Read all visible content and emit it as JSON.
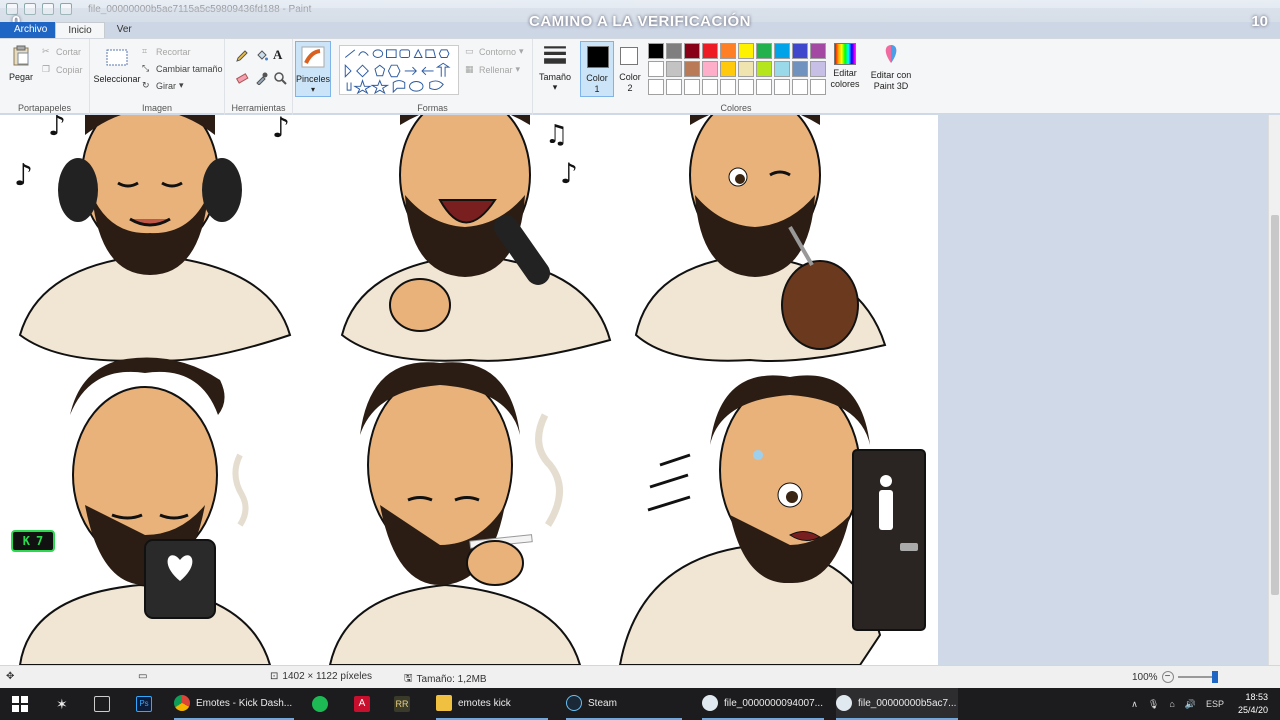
{
  "window": {
    "filename": "file_00000000b5ac7115a5c59809436fd188 - Paint",
    "stream_title": "CAMINO A LA VERIFICACIÓN",
    "counter_left": "0",
    "counter_right": "10"
  },
  "tabs": [
    "Archivo",
    "Inicio",
    "Ver"
  ],
  "ribbon": {
    "portapapeles": {
      "label": "Portapapeles",
      "paste": "Pegar",
      "cut": "Cortar",
      "copy": "Copiar"
    },
    "imagen": {
      "label": "Imagen",
      "select": "Seleccionar",
      "crop": "Recortar",
      "resize": "Cambiar tamaño",
      "rotate": "Girar"
    },
    "herramientas": {
      "label": "Herramientas"
    },
    "pinceles": "Pinceles",
    "formas": {
      "label": "Formas",
      "outline": "Contorno",
      "fill": "Rellenar"
    },
    "tamano": "Tamaño",
    "color1": "Color\n1",
    "color2": "Color\n2",
    "colores": {
      "label": "Colores",
      "edit": "Editar colores"
    },
    "paint3d": "Editar con Paint 3D"
  },
  "palette": [
    "#000000",
    "#7f7f7f",
    "#880015",
    "#ed1c24",
    "#ff7f27",
    "#fff200",
    "#22b14c",
    "#00a2e8",
    "#3f48cc",
    "#a349a4",
    "#ffffff",
    "#c3c3c3",
    "#b97a57",
    "#ffaec9",
    "#ffc90e",
    "#efe4b0",
    "#b5e61d",
    "#99d9ea",
    "#7092be",
    "#c8bfe7",
    "#ffffff",
    "#ffffff",
    "#ffffff",
    "#ffffff",
    "#ffffff",
    "#ffffff",
    "#ffffff",
    "#ffffff",
    "#ffffff",
    "#ffffff"
  ],
  "canvas": {
    "kick_badge": "7",
    "toilet_sign": "WC"
  },
  "status": {
    "dimensions": "1402 × 1122 píxeles",
    "size": "Tamaño: 1,2MB",
    "zoom": "100%"
  },
  "taskbar": {
    "items": [
      "Emotes - Kick Dash...",
      "emotes kick",
      "Steam",
      "file_0000000094007...",
      "file_00000000b5ac7..."
    ],
    "lang": "ESP",
    "time": "18:53",
    "date": "25/4/20"
  }
}
